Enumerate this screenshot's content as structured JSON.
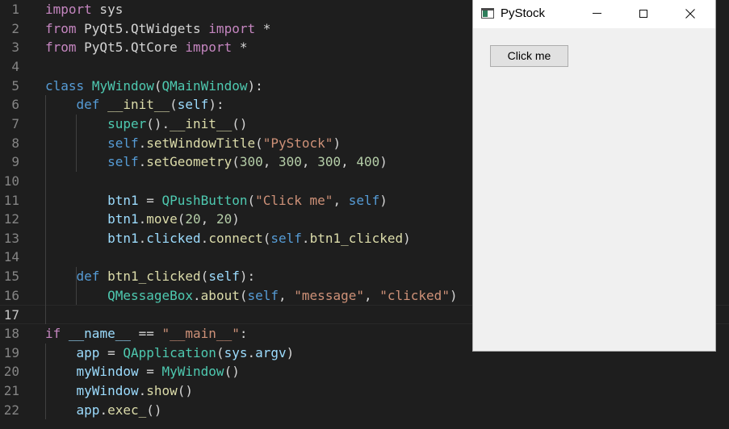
{
  "editor": {
    "current_line": 17,
    "lines": [
      {
        "num": "1",
        "tokens": [
          {
            "t": "import",
            "c": "kw"
          },
          {
            "t": " sys",
            "c": "plain"
          }
        ]
      },
      {
        "num": "2",
        "tokens": [
          {
            "t": "from",
            "c": "kw"
          },
          {
            "t": " PyQt5.QtWidgets ",
            "c": "plain"
          },
          {
            "t": "import",
            "c": "kw"
          },
          {
            "t": " *",
            "c": "plain"
          }
        ]
      },
      {
        "num": "3",
        "tokens": [
          {
            "t": "from",
            "c": "kw"
          },
          {
            "t": " PyQt5.QtCore ",
            "c": "plain"
          },
          {
            "t": "import",
            "c": "kw"
          },
          {
            "t": " *",
            "c": "plain"
          }
        ]
      },
      {
        "num": "4",
        "tokens": []
      },
      {
        "num": "5",
        "tokens": [
          {
            "t": "class",
            "c": "decl"
          },
          {
            "t": " ",
            "c": "plain"
          },
          {
            "t": "MyWindow",
            "c": "cls"
          },
          {
            "t": "(",
            "c": "plain"
          },
          {
            "t": "QMainWindow",
            "c": "cls"
          },
          {
            "t": "):",
            "c": "plain"
          }
        ]
      },
      {
        "num": "6",
        "tokens": [
          {
            "t": "    ",
            "c": "plain"
          },
          {
            "t": "def",
            "c": "decl"
          },
          {
            "t": " ",
            "c": "plain"
          },
          {
            "t": "__init__",
            "c": "fn"
          },
          {
            "t": "(",
            "c": "plain"
          },
          {
            "t": "self",
            "c": "var"
          },
          {
            "t": "):",
            "c": "plain"
          }
        ]
      },
      {
        "num": "7",
        "tokens": [
          {
            "t": "        ",
            "c": "plain"
          },
          {
            "t": "super",
            "c": "cls"
          },
          {
            "t": "().",
            "c": "plain"
          },
          {
            "t": "__init__",
            "c": "fn"
          },
          {
            "t": "()",
            "c": "plain"
          }
        ]
      },
      {
        "num": "8",
        "tokens": [
          {
            "t": "        ",
            "c": "plain"
          },
          {
            "t": "self",
            "c": "self"
          },
          {
            "t": ".",
            "c": "plain"
          },
          {
            "t": "setWindowTitle",
            "c": "fn"
          },
          {
            "t": "(",
            "c": "plain"
          },
          {
            "t": "\"PyStock\"",
            "c": "str"
          },
          {
            "t": ")",
            "c": "plain"
          }
        ]
      },
      {
        "num": "9",
        "tokens": [
          {
            "t": "        ",
            "c": "plain"
          },
          {
            "t": "self",
            "c": "self"
          },
          {
            "t": ".",
            "c": "plain"
          },
          {
            "t": "setGeometry",
            "c": "fn"
          },
          {
            "t": "(",
            "c": "plain"
          },
          {
            "t": "300",
            "c": "num"
          },
          {
            "t": ", ",
            "c": "plain"
          },
          {
            "t": "300",
            "c": "num"
          },
          {
            "t": ", ",
            "c": "plain"
          },
          {
            "t": "300",
            "c": "num"
          },
          {
            "t": ", ",
            "c": "plain"
          },
          {
            "t": "400",
            "c": "num"
          },
          {
            "t": ")",
            "c": "plain"
          }
        ]
      },
      {
        "num": "10",
        "tokens": []
      },
      {
        "num": "11",
        "tokens": [
          {
            "t": "        ",
            "c": "plain"
          },
          {
            "t": "btn1",
            "c": "var"
          },
          {
            "t": " = ",
            "c": "plain"
          },
          {
            "t": "QPushButton",
            "c": "cls"
          },
          {
            "t": "(",
            "c": "plain"
          },
          {
            "t": "\"Click me\"",
            "c": "str"
          },
          {
            "t": ", ",
            "c": "plain"
          },
          {
            "t": "self",
            "c": "self"
          },
          {
            "t": ")",
            "c": "plain"
          }
        ]
      },
      {
        "num": "12",
        "tokens": [
          {
            "t": "        ",
            "c": "plain"
          },
          {
            "t": "btn1",
            "c": "var"
          },
          {
            "t": ".",
            "c": "plain"
          },
          {
            "t": "move",
            "c": "fn"
          },
          {
            "t": "(",
            "c": "plain"
          },
          {
            "t": "20",
            "c": "num"
          },
          {
            "t": ", ",
            "c": "plain"
          },
          {
            "t": "20",
            "c": "num"
          },
          {
            "t": ")",
            "c": "plain"
          }
        ]
      },
      {
        "num": "13",
        "tokens": [
          {
            "t": "        ",
            "c": "plain"
          },
          {
            "t": "btn1",
            "c": "var"
          },
          {
            "t": ".",
            "c": "plain"
          },
          {
            "t": "clicked",
            "c": "var"
          },
          {
            "t": ".",
            "c": "plain"
          },
          {
            "t": "connect",
            "c": "fn"
          },
          {
            "t": "(",
            "c": "plain"
          },
          {
            "t": "self",
            "c": "self"
          },
          {
            "t": ".",
            "c": "plain"
          },
          {
            "t": "btn1_clicked",
            "c": "fn"
          },
          {
            "t": ")",
            "c": "plain"
          }
        ]
      },
      {
        "num": "14",
        "tokens": []
      },
      {
        "num": "15",
        "tokens": [
          {
            "t": "    ",
            "c": "plain"
          },
          {
            "t": "def",
            "c": "decl"
          },
          {
            "t": " ",
            "c": "plain"
          },
          {
            "t": "btn1_clicked",
            "c": "fn"
          },
          {
            "t": "(",
            "c": "plain"
          },
          {
            "t": "self",
            "c": "var"
          },
          {
            "t": "):",
            "c": "plain"
          }
        ]
      },
      {
        "num": "16",
        "tokens": [
          {
            "t": "        ",
            "c": "plain"
          },
          {
            "t": "QMessageBox",
            "c": "cls"
          },
          {
            "t": ".",
            "c": "plain"
          },
          {
            "t": "about",
            "c": "fn"
          },
          {
            "t": "(",
            "c": "plain"
          },
          {
            "t": "self",
            "c": "self"
          },
          {
            "t": ", ",
            "c": "plain"
          },
          {
            "t": "\"message\"",
            "c": "str"
          },
          {
            "t": ", ",
            "c": "plain"
          },
          {
            "t": "\"clicked\"",
            "c": "str"
          },
          {
            "t": ")",
            "c": "plain"
          }
        ]
      },
      {
        "num": "17",
        "tokens": []
      },
      {
        "num": "18",
        "tokens": [
          {
            "t": "if",
            "c": "kw"
          },
          {
            "t": " ",
            "c": "plain"
          },
          {
            "t": "__name__",
            "c": "var"
          },
          {
            "t": " == ",
            "c": "plain"
          },
          {
            "t": "\"__main__\"",
            "c": "str"
          },
          {
            "t": ":",
            "c": "plain"
          }
        ]
      },
      {
        "num": "19",
        "tokens": [
          {
            "t": "    ",
            "c": "plain"
          },
          {
            "t": "app",
            "c": "var"
          },
          {
            "t": " = ",
            "c": "plain"
          },
          {
            "t": "QApplication",
            "c": "cls"
          },
          {
            "t": "(",
            "c": "plain"
          },
          {
            "t": "sys",
            "c": "var"
          },
          {
            "t": ".",
            "c": "plain"
          },
          {
            "t": "argv",
            "c": "var"
          },
          {
            "t": ")",
            "c": "plain"
          }
        ]
      },
      {
        "num": "20",
        "tokens": [
          {
            "t": "    ",
            "c": "plain"
          },
          {
            "t": "myWindow",
            "c": "var"
          },
          {
            "t": " = ",
            "c": "plain"
          },
          {
            "t": "MyWindow",
            "c": "cls"
          },
          {
            "t": "()",
            "c": "plain"
          }
        ]
      },
      {
        "num": "21",
        "tokens": [
          {
            "t": "    ",
            "c": "plain"
          },
          {
            "t": "myWindow",
            "c": "var"
          },
          {
            "t": ".",
            "c": "plain"
          },
          {
            "t": "show",
            "c": "fn"
          },
          {
            "t": "()",
            "c": "plain"
          }
        ]
      },
      {
        "num": "22",
        "tokens": [
          {
            "t": "    ",
            "c": "plain"
          },
          {
            "t": "app",
            "c": "var"
          },
          {
            "t": ".",
            "c": "plain"
          },
          {
            "t": "exec_",
            "c": "fn"
          },
          {
            "t": "()",
            "c": "plain"
          }
        ]
      }
    ]
  },
  "window": {
    "title": "PyStock",
    "app_icon": "window-app-icon",
    "minimize_icon": "minimize-icon",
    "maximize_icon": "maximize-icon",
    "close_icon": "close-icon",
    "button_label": "Click me"
  },
  "colors": {
    "editor_bg": "#1e1e1e",
    "keyword": "#c586c0",
    "declaration": "#569cd6",
    "class": "#4ec9b0",
    "function": "#dcdcaa",
    "string": "#ce9178",
    "number": "#b5cea8",
    "variable": "#9cdcfe",
    "window_bg": "#f0f0f0"
  }
}
